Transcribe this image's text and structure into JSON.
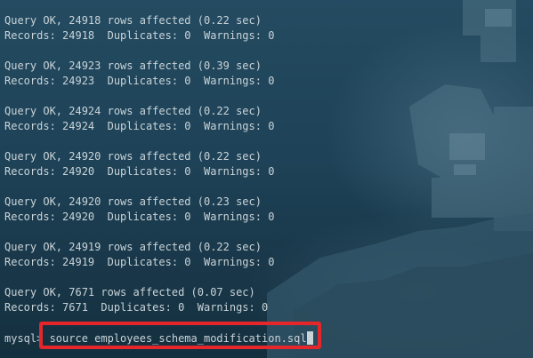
{
  "terminal": {
    "output_lines": [
      "Query OK, 24918 rows affected (0.22 sec)",
      "Records: 24918  Duplicates: 0  Warnings: 0",
      "",
      "Query OK, 24923 rows affected (0.39 sec)",
      "Records: 24923  Duplicates: 0  Warnings: 0",
      "",
      "Query OK, 24924 rows affected (0.22 sec)",
      "Records: 24924  Duplicates: 0  Warnings: 0",
      "",
      "Query OK, 24920 rows affected (0.22 sec)",
      "Records: 24920  Duplicates: 0  Warnings: 0",
      "",
      "Query OK, 24920 rows affected (0.23 sec)",
      "Records: 24920  Duplicates: 0  Warnings: 0",
      "",
      "Query OK, 24919 rows affected (0.22 sec)",
      "Records: 24919  Duplicates: 0  Warnings: 0",
      "",
      "Query OK, 7671 rows affected (0.07 sec)",
      "Records: 7671  Duplicates: 0  Warnings: 0"
    ],
    "prompt": "mysql> ",
    "command": "source employees_schema_modification.sql"
  },
  "colors": {
    "text": "#c9d3d8",
    "background": "#1e4257",
    "highlight_border": "#e5262b"
  }
}
